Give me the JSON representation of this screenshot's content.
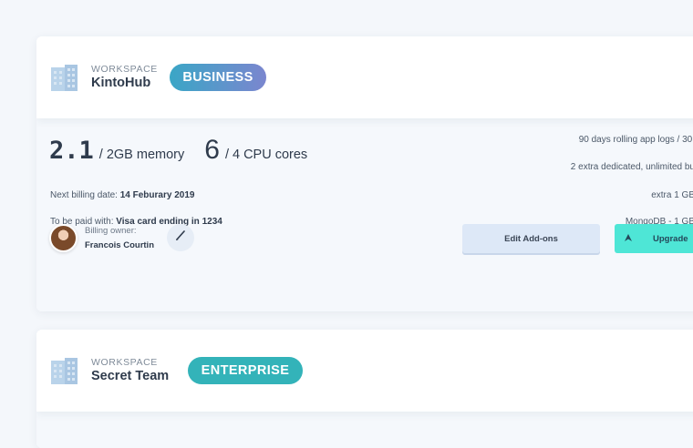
{
  "workspaces": [
    {
      "label": "WORKSPACE",
      "name": "KintoHub",
      "plan": "BUSINESS",
      "memory": {
        "used": "2.1",
        "limit": "/ 2GB memory"
      },
      "cpu": {
        "used": "6",
        "limit": "/ 4 CPU cores"
      },
      "billing": {
        "next_label": "Next billing date:",
        "next_date": "14 Feburary 2019",
        "paid_label": "To be paid with:",
        "paid_with": "Visa card ending in 1234"
      },
      "addons": [
        "90 days rolling app logs / 30,",
        "2 extra dedicated, unlimited bu",
        "extra 1 GB",
        "MongoDB  - 1 GB"
      ],
      "owner": {
        "label": "Billing owner:",
        "name": "Francois Courtin"
      },
      "edit_addons_label": "Edit Add-ons",
      "upgrade_label": "Upgrade"
    },
    {
      "label": "WORKSPACE",
      "name": "Secret Team",
      "plan": "ENTERPRISE"
    }
  ],
  "colors": {
    "business_badge_start": "#3aa6c6",
    "business_badge_end": "#7b86cf",
    "enterprise_badge": "#33b3b9",
    "upgrade_button": "#4ee6d6",
    "edit_addons_button": "#dde8f7"
  }
}
